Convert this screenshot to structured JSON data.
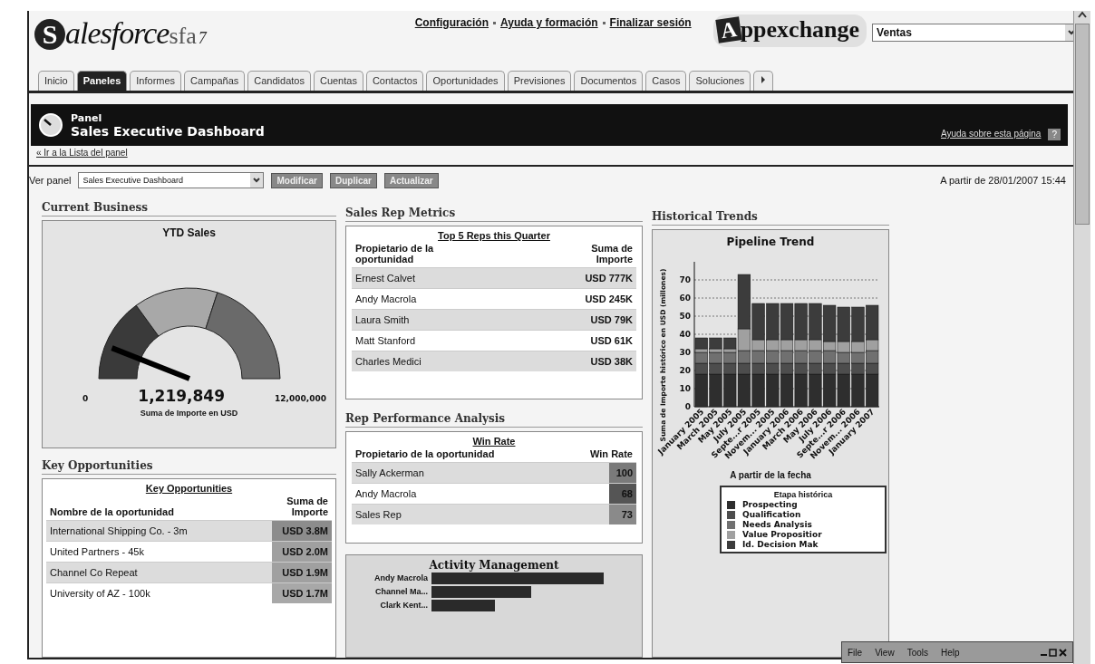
{
  "header": {
    "logo": {
      "initial": "S",
      "name": "alesforce",
      "suffix": "sfa",
      "version": "7"
    },
    "links": [
      "Configuración",
      "Ayuda y formación",
      "Finalizar sesión"
    ],
    "appexchange": {
      "initial": "A",
      "name": "ppexchange"
    },
    "app_select": {
      "value": "Ventas"
    }
  },
  "tabs": [
    {
      "label": "Inicio",
      "selected": false
    },
    {
      "label": "Paneles",
      "selected": true
    },
    {
      "label": "Informes",
      "selected": false
    },
    {
      "label": "Campañas",
      "selected": false
    },
    {
      "label": "Candidatos",
      "selected": false
    },
    {
      "label": "Cuentas",
      "selected": false
    },
    {
      "label": "Contactos",
      "selected": false
    },
    {
      "label": "Oportunidades",
      "selected": false
    },
    {
      "label": "Previsiones",
      "selected": false
    },
    {
      "label": "Documentos",
      "selected": false
    },
    {
      "label": "Casos",
      "selected": false
    },
    {
      "label": "Soluciones",
      "selected": false
    }
  ],
  "banner": {
    "kicker": "Panel",
    "title": "Sales Executive Dashboard",
    "help_link": "Ayuda sobre esta página",
    "help_badge": "?"
  },
  "back_link": "« Ir a la Lista del panel",
  "toolbar": {
    "label": "Ver panel",
    "select": "Sales Executive Dashboard",
    "buttons": [
      "Modificar",
      "Duplicar",
      "Actualizar"
    ],
    "timestamp": "A partir de 28/01/2007 15:44"
  },
  "current_business": {
    "heading": "Current Business",
    "gauge": {
      "title": "YTD Sales",
      "min": "0",
      "max": "12,000,000",
      "value": "1,219,849",
      "caption": "Suma de Importe en USD"
    }
  },
  "key_opportunities": {
    "heading": "Key Opportunities",
    "title": "Key Opportunities",
    "columns": [
      "Nombre de la oportunidad",
      "Suma de Importe"
    ],
    "rows": [
      {
        "name": "International Shipping Co. - 3m",
        "amount": "USD 3.8M",
        "color": "#8c8c8c"
      },
      {
        "name": "United Partners - 45k",
        "amount": "USD 2.0M",
        "color": "#a0a0a0"
      },
      {
        "name": "Channel Co Repeat",
        "amount": "USD 1.9M",
        "color": "#a0a0a0"
      },
      {
        "name": "University of AZ - 100k",
        "amount": "USD 1.7M",
        "color": "#a8a8a8"
      }
    ]
  },
  "sales_rep_metrics": {
    "heading": "Sales Rep Metrics",
    "title": "Top 5 Reps this Quarter",
    "columns": [
      "Propietario de la oportunidad",
      "Suma de Importe"
    ],
    "rows": [
      {
        "name": "Ernest Calvet",
        "amount": "USD 777K"
      },
      {
        "name": "Andy Macrola",
        "amount": "USD 245K"
      },
      {
        "name": "Laura Smith",
        "amount": "USD 79K"
      },
      {
        "name": "Matt Stanford",
        "amount": "USD 61K"
      },
      {
        "name": "Charles Medici",
        "amount": "USD 38K"
      }
    ]
  },
  "rep_performance": {
    "heading": "Rep Performance Analysis",
    "title": "Win Rate",
    "columns": [
      "Propietario de la oportunidad",
      "Win Rate"
    ],
    "rows": [
      {
        "name": "Sally Ackerman",
        "rate": "100",
        "color": "#7a7a7a"
      },
      {
        "name": "Andy Macrola",
        "rate": "68",
        "color": "#555555"
      },
      {
        "name": "Sales Rep",
        "rate": "73",
        "color": "#8a8a8a"
      }
    ]
  },
  "activity_management": {
    "title": "Activity Management",
    "rows": [
      "Andy Macrola",
      "Channel Ma...",
      "Clark Kent..."
    ]
  },
  "historical_trends": {
    "heading": "Historical Trends",
    "chart_data": {
      "type": "bar",
      "stacked": true,
      "title": "Pipeline Trend",
      "xlabel": "A partir de la fecha",
      "ylabel": "Suma de Importe histórico en USD (millones)",
      "categories": [
        "January 2005",
        "March 2005",
        "May 2005",
        "July 2005",
        "Septe...r 2005",
        "Novem... 2005",
        "January 2006",
        "March 2006",
        "May 2006",
        "July 2006",
        "Septe...r 2006",
        "Novem... 2006",
        "January 2007"
      ],
      "ylim": [
        0,
        80
      ],
      "grid": true,
      "yticks": [
        0,
        10,
        20,
        30,
        40,
        50,
        60,
        70
      ],
      "legend_title": "Etapa histórica",
      "series": [
        {
          "name": "Prospecting",
          "color": "#2e2e2e",
          "values": [
            18,
            18,
            18,
            18,
            18,
            18,
            18,
            18,
            18,
            18,
            18,
            18,
            18
          ]
        },
        {
          "name": "Qualification",
          "color": "#4d4d4d",
          "values": [
            6,
            6,
            6,
            6,
            6,
            6,
            6,
            6,
            6,
            6,
            6,
            6,
            6
          ]
        },
        {
          "name": "Needs Analysis",
          "color": "#707070",
          "values": [
            6,
            6,
            6,
            7,
            7,
            7,
            7,
            7,
            7,
            7,
            6,
            6,
            7
          ]
        },
        {
          "name": "Value Propositior",
          "color": "#a0a0a0",
          "values": [
            2,
            2,
            2,
            12,
            6,
            6,
            6,
            6,
            6,
            5,
            6,
            6,
            6
          ]
        },
        {
          "name": "Id. Decision Mak",
          "color": "#3c3c3c",
          "values": [
            6,
            6,
            6,
            30,
            20,
            20,
            20,
            20,
            20,
            20,
            19,
            19,
            19
          ]
        }
      ]
    }
  },
  "popup_window": {
    "menu": [
      "File",
      "View",
      "Tools",
      "Help"
    ]
  }
}
